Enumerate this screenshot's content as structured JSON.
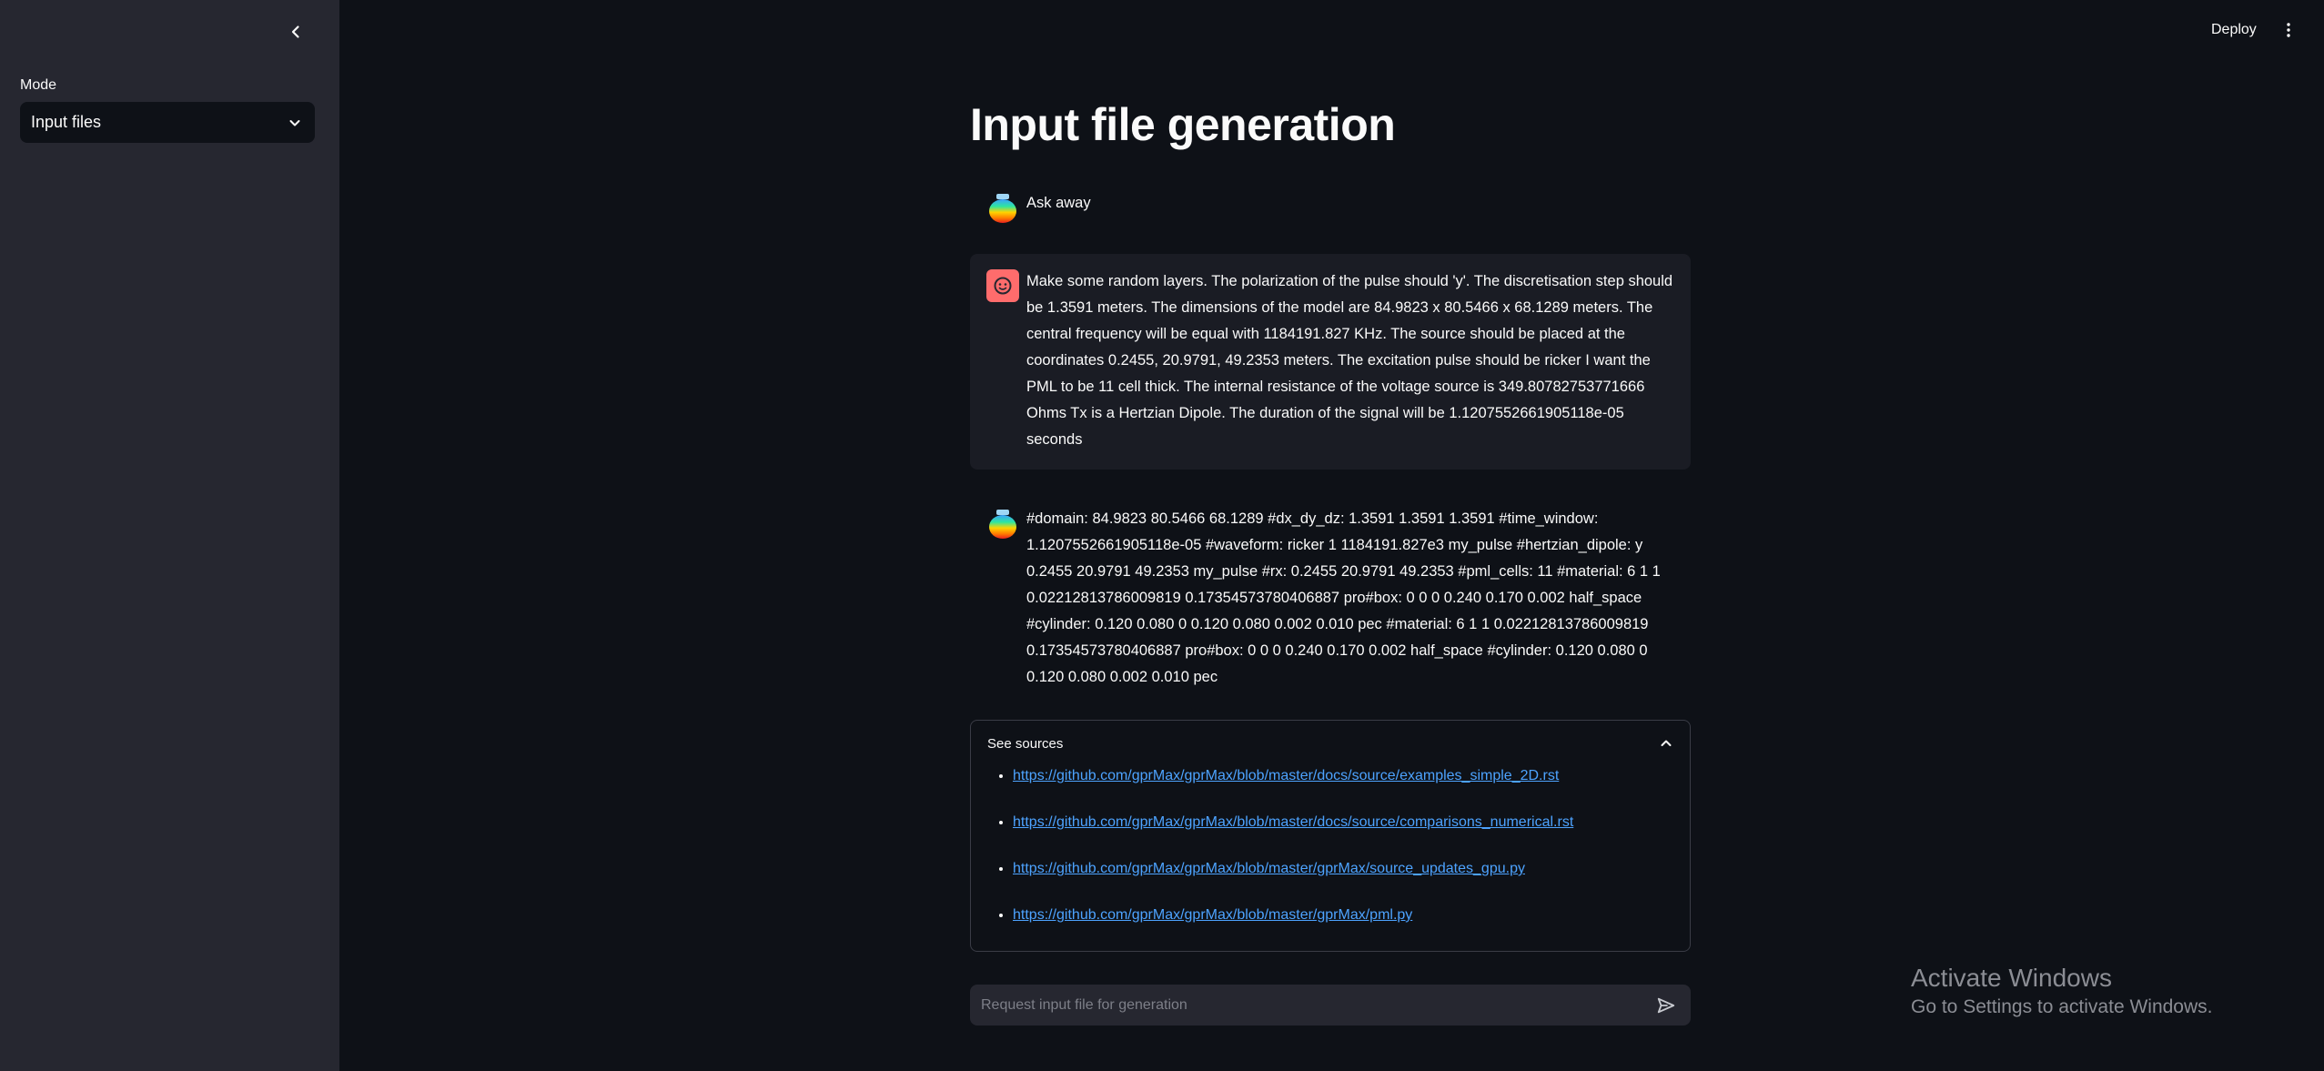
{
  "sidebar": {
    "mode_label": "Mode",
    "mode_selected": "Input files"
  },
  "topbar": {
    "deploy_label": "Deploy"
  },
  "main": {
    "title": "Input file generation",
    "messages": [
      {
        "role": "assistant",
        "text": "Ask away"
      },
      {
        "role": "user",
        "text": "Make some random layers. The polarization of the pulse should 'y'. The discretisation step should be 1.3591 meters. The dimensions of the model are 84.9823 x 80.5466 x 68.1289 meters. The central frequency will be equal with 1184191.827 KHz. The source should be placed at the coordinates 0.2455, 20.9791, 49.2353 meters. The excitation pulse should be ricker I want the PML to be 11 cell thick. The internal resistance of the voltage source is 349.80782753771666 Ohms Tx is a Hertzian Dipole. The duration of the signal will be 1.1207552661905118e-05 seconds"
      },
      {
        "role": "assistant",
        "text": "#domain: 84.9823 80.5466 68.1289 #dx_dy_dz: 1.3591 1.3591 1.3591 #time_window: 1.1207552661905118e-05 #waveform: ricker 1 1184191.827e3 my_pulse #hertzian_dipole: y 0.2455 20.9791 49.2353 my_pulse #rx: 0.2455 20.9791 49.2353 #pml_cells: 11 #material: 6 1 1 0.02212813786009819 0.17354573780406887 pro#box: 0 0 0 0.240 0.170 0.002 half_space #cylinder: 0.120 0.080 0 0.120 0.080 0.002 0.010 pec #material: 6 1 1 0.02212813786009819 0.17354573780406887 pro#box: 0 0 0 0.240 0.170 0.002 half_space #cylinder: 0.120 0.080 0 0.120 0.080 0.002 0.010 pec"
      }
    ],
    "sources": {
      "header": "See sources",
      "links": [
        "https://github.com/gprMax/gprMax/blob/master/docs/source/examples_simple_2D.rst",
        "https://github.com/gprMax/gprMax/blob/master/docs/source/comparisons_numerical.rst",
        "https://github.com/gprMax/gprMax/blob/master/gprMax/source_updates_gpu.py",
        "https://github.com/gprMax/gprMax/blob/master/gprMax/pml.py"
      ]
    },
    "chat_input": {
      "placeholder": "Request input file for generation",
      "value": ""
    }
  },
  "watermark": {
    "title": "Activate Windows",
    "subtitle": "Go to Settings to activate Windows."
  },
  "icons": {
    "collapse": "chevron-left-icon",
    "dropdown": "chevron-down-icon",
    "menu": "kebab-menu-icon",
    "expander": "chevron-up-icon",
    "send": "send-icon",
    "user_avatar": "face-icon",
    "assistant_avatar": "rainbow-jar-icon"
  },
  "colors": {
    "background": "#0e1117",
    "sidebar": "#262730",
    "user_avatar": "#ff6c6c",
    "link": "#4da3ff"
  }
}
